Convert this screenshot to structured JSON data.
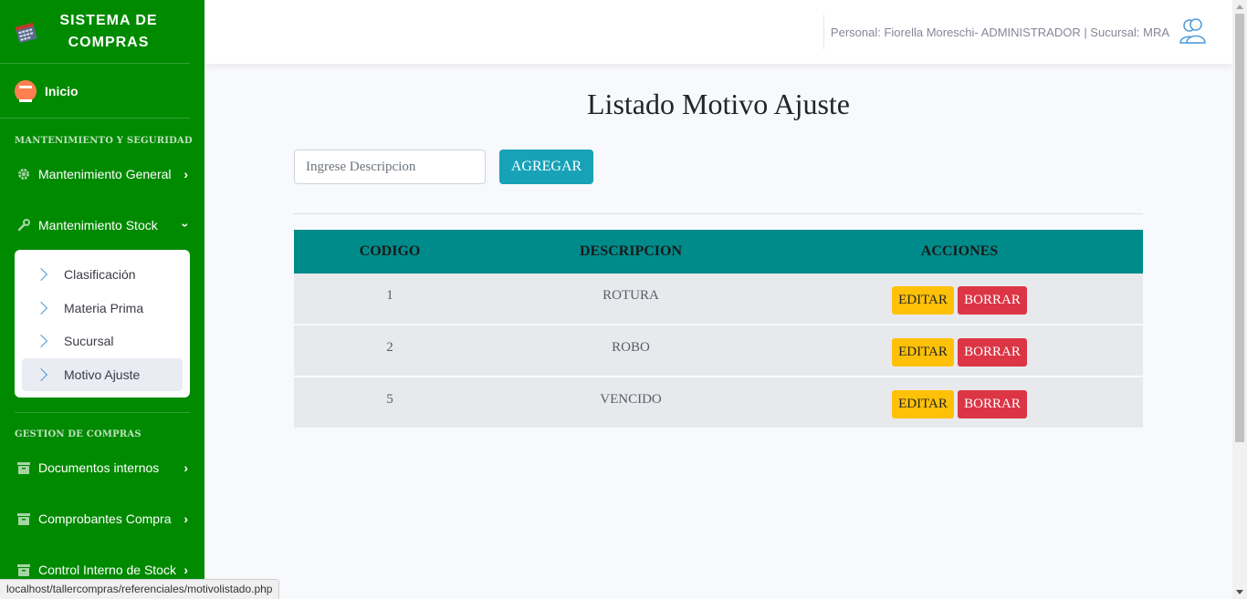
{
  "brand": {
    "title": "SISTEMA DE COMPRAS",
    "title_line1": "SISTEMA DE",
    "title_line2": "COMPRAS"
  },
  "nav": {
    "home_label": "Inicio",
    "section1": "MANTENIMIENTO Y SEGURIDAD",
    "mantenimiento_general": "Mantenimiento General",
    "mantenimiento_stock": "Mantenimiento Stock",
    "submenu": [
      "Clasificación",
      "Materia Prima",
      "Sucursal",
      "Motivo Ajuste"
    ],
    "section2": "GESTION DE COMPRAS",
    "documentos_internos": "Documentos internos",
    "comprobantes_compra": "Comprobantes Compra",
    "control_interno": "Control Interno de Stock"
  },
  "topbar": {
    "user_info": "Personal: Fiorella Moreschi- ADMINISTRADOR | Sucursal: MRA"
  },
  "main": {
    "title": "Listado Motivo Ajuste",
    "search_placeholder": "Ingrese Descripcion",
    "add_label": "AGREGAR",
    "table": {
      "headers": [
        "CODIGO",
        "DESCRIPCION",
        "ACCIONES"
      ],
      "rows": [
        {
          "codigo": "1",
          "descripcion": "ROTURA"
        },
        {
          "codigo": "2",
          "descripcion": "ROBO"
        },
        {
          "codigo": "5",
          "descripcion": "VENCIDO"
        }
      ],
      "edit_label": "EDITAR",
      "delete_label": "BORRAR"
    }
  },
  "status_url": "localhost/tallercompras/referenciales/motivolistado.php",
  "colors": {
    "sidebar": "#008a00",
    "header": "#008b8b",
    "edit": "#ffc107",
    "delete": "#dc3545",
    "add": "#17a2b8"
  }
}
